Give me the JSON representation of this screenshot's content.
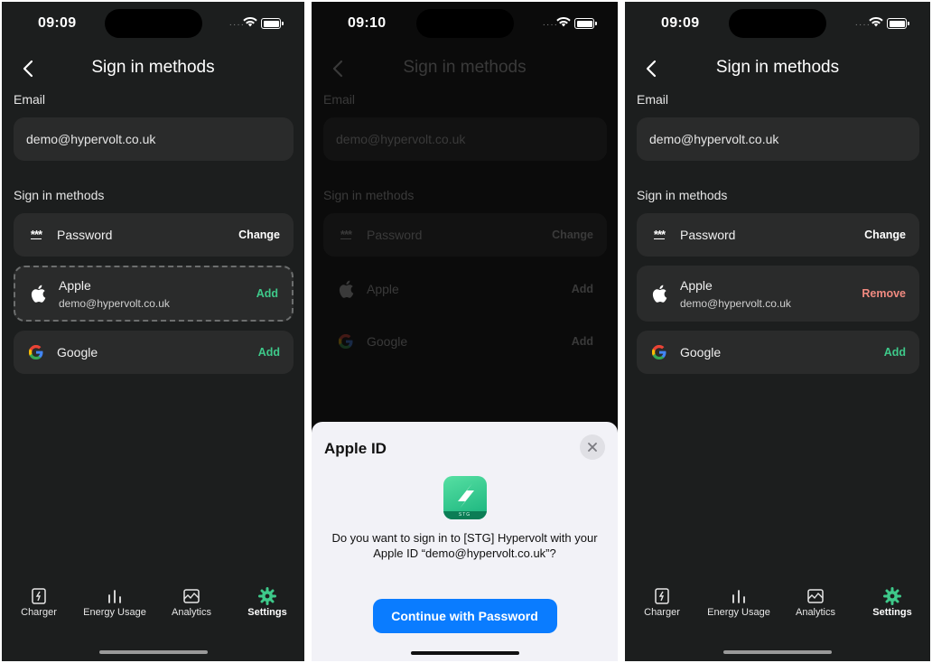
{
  "screen1": {
    "time": "09:09",
    "title": "Sign in methods",
    "email_label": "Email",
    "email_value": "demo@hypervolt.co.uk",
    "methods_label": "Sign in methods",
    "methods": [
      {
        "label": "Password",
        "sub": "",
        "action": "Change"
      },
      {
        "label": "Apple",
        "sub": "demo@hypervolt.co.uk",
        "action": "Add"
      },
      {
        "label": "Google",
        "sub": "",
        "action": "Add"
      }
    ],
    "tabs": [
      "Charger",
      "Energy Usage",
      "Analytics",
      "Settings"
    ]
  },
  "screen2": {
    "time": "09:10",
    "title": "Sign in methods",
    "email_label": "Email",
    "email_value": "demo@hypervolt.co.uk",
    "methods_label": "Sign in methods",
    "methods": [
      {
        "label": "Password",
        "action": "Change"
      },
      {
        "label": "Apple",
        "action": "Add"
      },
      {
        "label": "Google",
        "action": "Add"
      }
    ],
    "sheet": {
      "title": "Apple ID",
      "app_badge": "STG",
      "message": "Do you want to sign in to [STG] Hypervolt with your Apple ID “demo@hypervolt.co.uk”?",
      "button": "Continue with Password"
    }
  },
  "screen3": {
    "time": "09:09",
    "title": "Sign in methods",
    "email_label": "Email",
    "email_value": "demo@hypervolt.co.uk",
    "methods_label": "Sign in methods",
    "methods": [
      {
        "label": "Password",
        "sub": "",
        "action": "Change"
      },
      {
        "label": "Apple",
        "sub": "demo@hypervolt.co.uk",
        "action": "Remove"
      },
      {
        "label": "Google",
        "sub": "",
        "action": "Add"
      }
    ],
    "tabs": [
      "Charger",
      "Energy Usage",
      "Analytics",
      "Settings"
    ]
  },
  "colors": {
    "accent_green": "#3ec98a",
    "remove_red": "#f08a80",
    "ios_blue": "#0a7cff"
  }
}
